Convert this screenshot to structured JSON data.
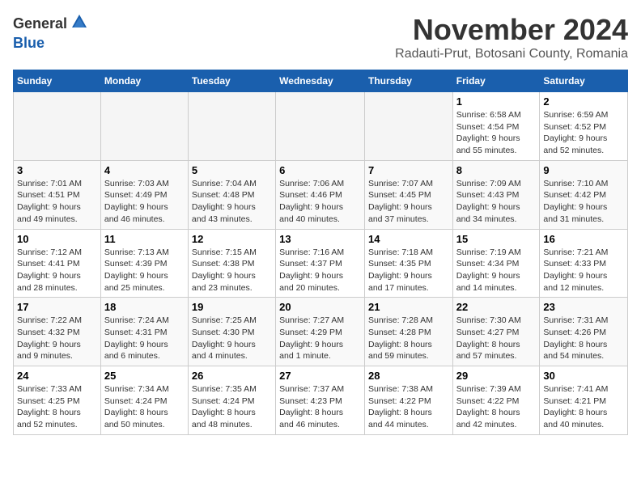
{
  "logo": {
    "general": "General",
    "blue": "Blue"
  },
  "title": "November 2024",
  "subtitle": "Radauti-Prut, Botosani County, Romania",
  "days_header": [
    "Sunday",
    "Monday",
    "Tuesday",
    "Wednesday",
    "Thursday",
    "Friday",
    "Saturday"
  ],
  "weeks": [
    [
      {
        "day": "",
        "details": ""
      },
      {
        "day": "",
        "details": ""
      },
      {
        "day": "",
        "details": ""
      },
      {
        "day": "",
        "details": ""
      },
      {
        "day": "",
        "details": ""
      },
      {
        "day": "1",
        "details": "Sunrise: 6:58 AM\nSunset: 4:54 PM\nDaylight: 9 hours\nand 55 minutes."
      },
      {
        "day": "2",
        "details": "Sunrise: 6:59 AM\nSunset: 4:52 PM\nDaylight: 9 hours\nand 52 minutes."
      }
    ],
    [
      {
        "day": "3",
        "details": "Sunrise: 7:01 AM\nSunset: 4:51 PM\nDaylight: 9 hours\nand 49 minutes."
      },
      {
        "day": "4",
        "details": "Sunrise: 7:03 AM\nSunset: 4:49 PM\nDaylight: 9 hours\nand 46 minutes."
      },
      {
        "day": "5",
        "details": "Sunrise: 7:04 AM\nSunset: 4:48 PM\nDaylight: 9 hours\nand 43 minutes."
      },
      {
        "day": "6",
        "details": "Sunrise: 7:06 AM\nSunset: 4:46 PM\nDaylight: 9 hours\nand 40 minutes."
      },
      {
        "day": "7",
        "details": "Sunrise: 7:07 AM\nSunset: 4:45 PM\nDaylight: 9 hours\nand 37 minutes."
      },
      {
        "day": "8",
        "details": "Sunrise: 7:09 AM\nSunset: 4:43 PM\nDaylight: 9 hours\nand 34 minutes."
      },
      {
        "day": "9",
        "details": "Sunrise: 7:10 AM\nSunset: 4:42 PM\nDaylight: 9 hours\nand 31 minutes."
      }
    ],
    [
      {
        "day": "10",
        "details": "Sunrise: 7:12 AM\nSunset: 4:41 PM\nDaylight: 9 hours\nand 28 minutes."
      },
      {
        "day": "11",
        "details": "Sunrise: 7:13 AM\nSunset: 4:39 PM\nDaylight: 9 hours\nand 25 minutes."
      },
      {
        "day": "12",
        "details": "Sunrise: 7:15 AM\nSunset: 4:38 PM\nDaylight: 9 hours\nand 23 minutes."
      },
      {
        "day": "13",
        "details": "Sunrise: 7:16 AM\nSunset: 4:37 PM\nDaylight: 9 hours\nand 20 minutes."
      },
      {
        "day": "14",
        "details": "Sunrise: 7:18 AM\nSunset: 4:35 PM\nDaylight: 9 hours\nand 17 minutes."
      },
      {
        "day": "15",
        "details": "Sunrise: 7:19 AM\nSunset: 4:34 PM\nDaylight: 9 hours\nand 14 minutes."
      },
      {
        "day": "16",
        "details": "Sunrise: 7:21 AM\nSunset: 4:33 PM\nDaylight: 9 hours\nand 12 minutes."
      }
    ],
    [
      {
        "day": "17",
        "details": "Sunrise: 7:22 AM\nSunset: 4:32 PM\nDaylight: 9 hours\nand 9 minutes."
      },
      {
        "day": "18",
        "details": "Sunrise: 7:24 AM\nSunset: 4:31 PM\nDaylight: 9 hours\nand 6 minutes."
      },
      {
        "day": "19",
        "details": "Sunrise: 7:25 AM\nSunset: 4:30 PM\nDaylight: 9 hours\nand 4 minutes."
      },
      {
        "day": "20",
        "details": "Sunrise: 7:27 AM\nSunset: 4:29 PM\nDaylight: 9 hours\nand 1 minute."
      },
      {
        "day": "21",
        "details": "Sunrise: 7:28 AM\nSunset: 4:28 PM\nDaylight: 8 hours\nand 59 minutes."
      },
      {
        "day": "22",
        "details": "Sunrise: 7:30 AM\nSunset: 4:27 PM\nDaylight: 8 hours\nand 57 minutes."
      },
      {
        "day": "23",
        "details": "Sunrise: 7:31 AM\nSunset: 4:26 PM\nDaylight: 8 hours\nand 54 minutes."
      }
    ],
    [
      {
        "day": "24",
        "details": "Sunrise: 7:33 AM\nSunset: 4:25 PM\nDaylight: 8 hours\nand 52 minutes."
      },
      {
        "day": "25",
        "details": "Sunrise: 7:34 AM\nSunset: 4:24 PM\nDaylight: 8 hours\nand 50 minutes."
      },
      {
        "day": "26",
        "details": "Sunrise: 7:35 AM\nSunset: 4:24 PM\nDaylight: 8 hours\nand 48 minutes."
      },
      {
        "day": "27",
        "details": "Sunrise: 7:37 AM\nSunset: 4:23 PM\nDaylight: 8 hours\nand 46 minutes."
      },
      {
        "day": "28",
        "details": "Sunrise: 7:38 AM\nSunset: 4:22 PM\nDaylight: 8 hours\nand 44 minutes."
      },
      {
        "day": "29",
        "details": "Sunrise: 7:39 AM\nSunset: 4:22 PM\nDaylight: 8 hours\nand 42 minutes."
      },
      {
        "day": "30",
        "details": "Sunrise: 7:41 AM\nSunset: 4:21 PM\nDaylight: 8 hours\nand 40 minutes."
      }
    ]
  ]
}
